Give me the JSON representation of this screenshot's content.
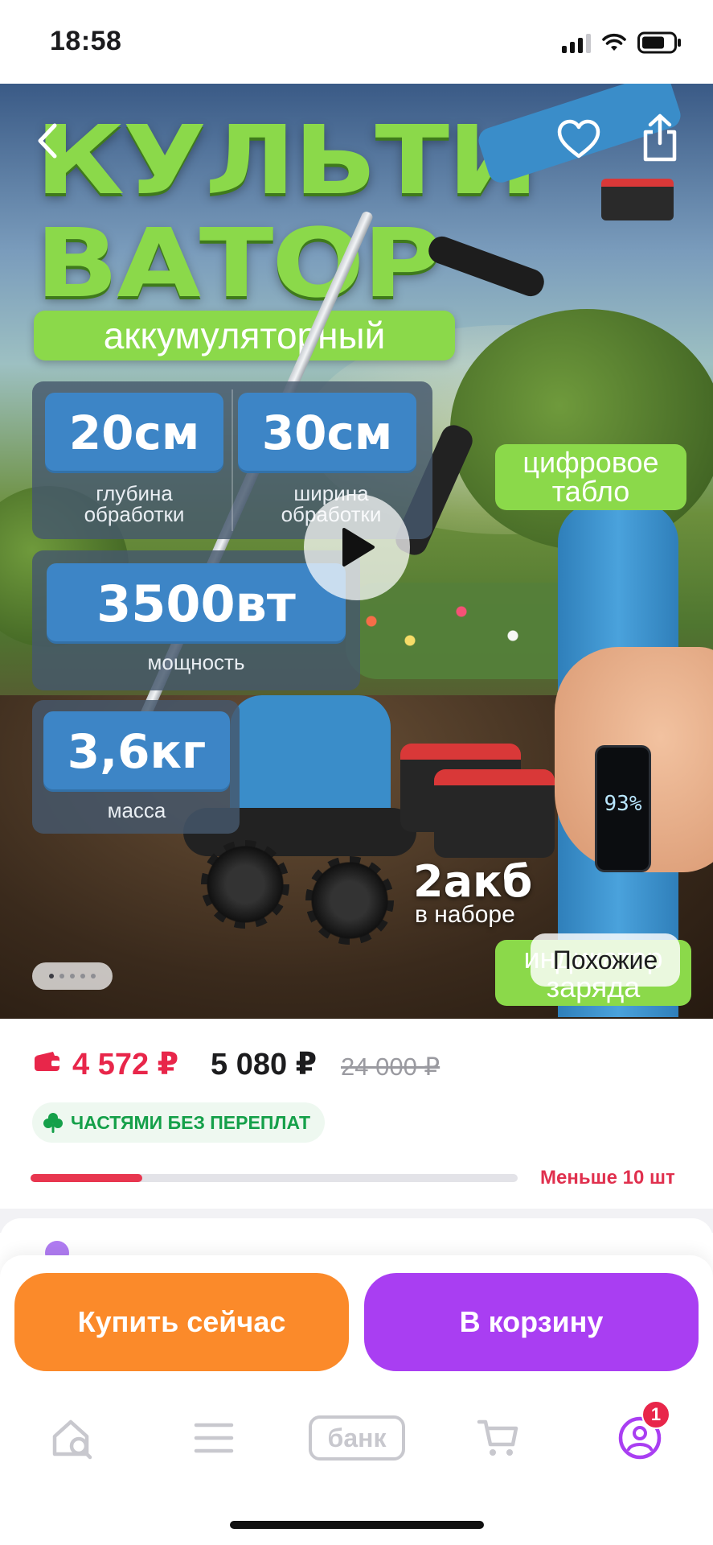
{
  "status_bar": {
    "time": "18:58"
  },
  "hero": {
    "title_line1": "КУЛЬТИ",
    "title_line2": "ВАТОР",
    "subtitle": "аккумуляторный",
    "specs": [
      {
        "value": "20см",
        "caption": "глубина обработки"
      },
      {
        "value": "30см",
        "caption": "ширина обработки"
      },
      {
        "value": "3500вт",
        "caption": "мощность"
      },
      {
        "value": "3,6кг",
        "caption": "масса"
      }
    ],
    "feature_display": "цифровое табло",
    "feature_charge": "индикатор заряда",
    "display_reading": "93%",
    "batteries_main": "2акб",
    "batteries_sub": "в наборе",
    "similar_label": "Похожие",
    "gallery": {
      "count": 5,
      "active": 1
    }
  },
  "price": {
    "card_price": "4 572 ₽",
    "price": "5 080 ₽",
    "old_price": "24 000 ₽",
    "installments": "ЧАСТЯМИ БЕЗ ПЕРЕПЛАТ",
    "stock_fraction": 0.23,
    "stock_text": "Меньше 10 шт"
  },
  "actions": {
    "buy_now": "Купить сейчас",
    "add_to_cart": "В корзину"
  },
  "tab_bar": {
    "bank_label": "банк",
    "notifications": "1"
  },
  "colors": {
    "accent_green": "#8bd94a",
    "price_red": "#e8264a",
    "buy_orange": "#fb8a2a",
    "cart_purple": "#a93ef2"
  }
}
